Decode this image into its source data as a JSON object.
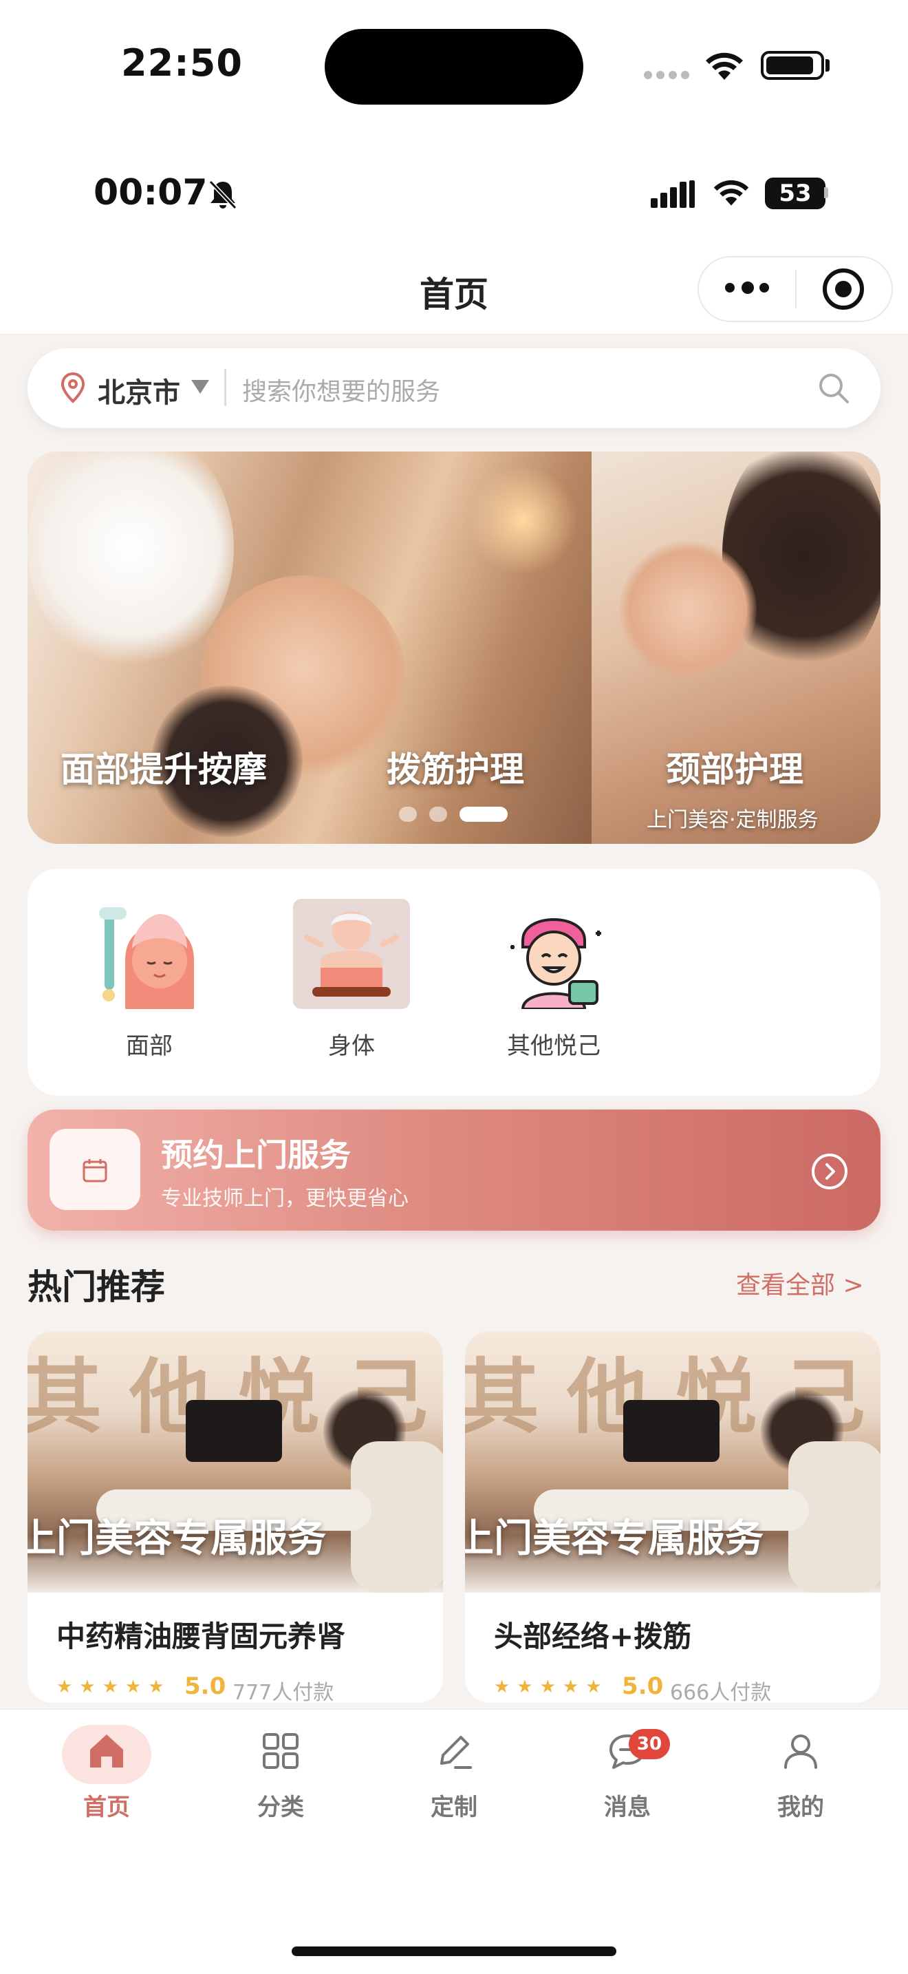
{
  "system_status": {
    "time": "22:50"
  },
  "inner_status": {
    "time": "00:07",
    "battery": "53"
  },
  "header": {
    "title": "首页"
  },
  "search": {
    "city": "北京市",
    "placeholder": "搜索你想要的服务"
  },
  "banner": {
    "slides": [
      {
        "title": "面部提升按摩"
      },
      {
        "title": "拨筋护理"
      },
      {
        "title": "颈部护理",
        "subtitle": "上门美容·定制服务"
      }
    ],
    "dots": 3,
    "active_dot": 3
  },
  "categories": [
    {
      "label": "面部",
      "icon": "face-roller-icon"
    },
    {
      "label": "身体",
      "icon": "body-care-icon"
    },
    {
      "label": "其他悦己",
      "icon": "self-care-icon"
    }
  ],
  "booking": {
    "title": "预约上门服务",
    "subtitle": "专业技师上门，更快更省心"
  },
  "hot": {
    "title": "热门推荐",
    "more": "查看全部 >",
    "items": [
      {
        "image_text": "上门美容专属服务",
        "image_big_text": "其他悦己",
        "name": "中药精油腰背固元养肾",
        "rating": "5.0",
        "paid": "777人付款",
        "stars": "★★★★★"
      },
      {
        "image_text": "上门美容专属服务",
        "image_big_text": "其他悦己",
        "name": "头部经络+拨筋",
        "rating": "5.0",
        "paid": "666人付款",
        "stars": "★★★★★"
      }
    ]
  },
  "tabbar": {
    "items": [
      {
        "label": "首页",
        "icon": "home-icon",
        "active": true
      },
      {
        "label": "分类",
        "icon": "grid-icon"
      },
      {
        "label": "定制",
        "icon": "edit-icon"
      },
      {
        "label": "消息",
        "icon": "chat-icon",
        "badge": "30"
      },
      {
        "label": "我的",
        "icon": "user-icon"
      }
    ]
  },
  "colors": {
    "accent": "#d06d64",
    "star": "#f0b43a",
    "badge": "#e0463a",
    "background": "#f6f2f0"
  }
}
